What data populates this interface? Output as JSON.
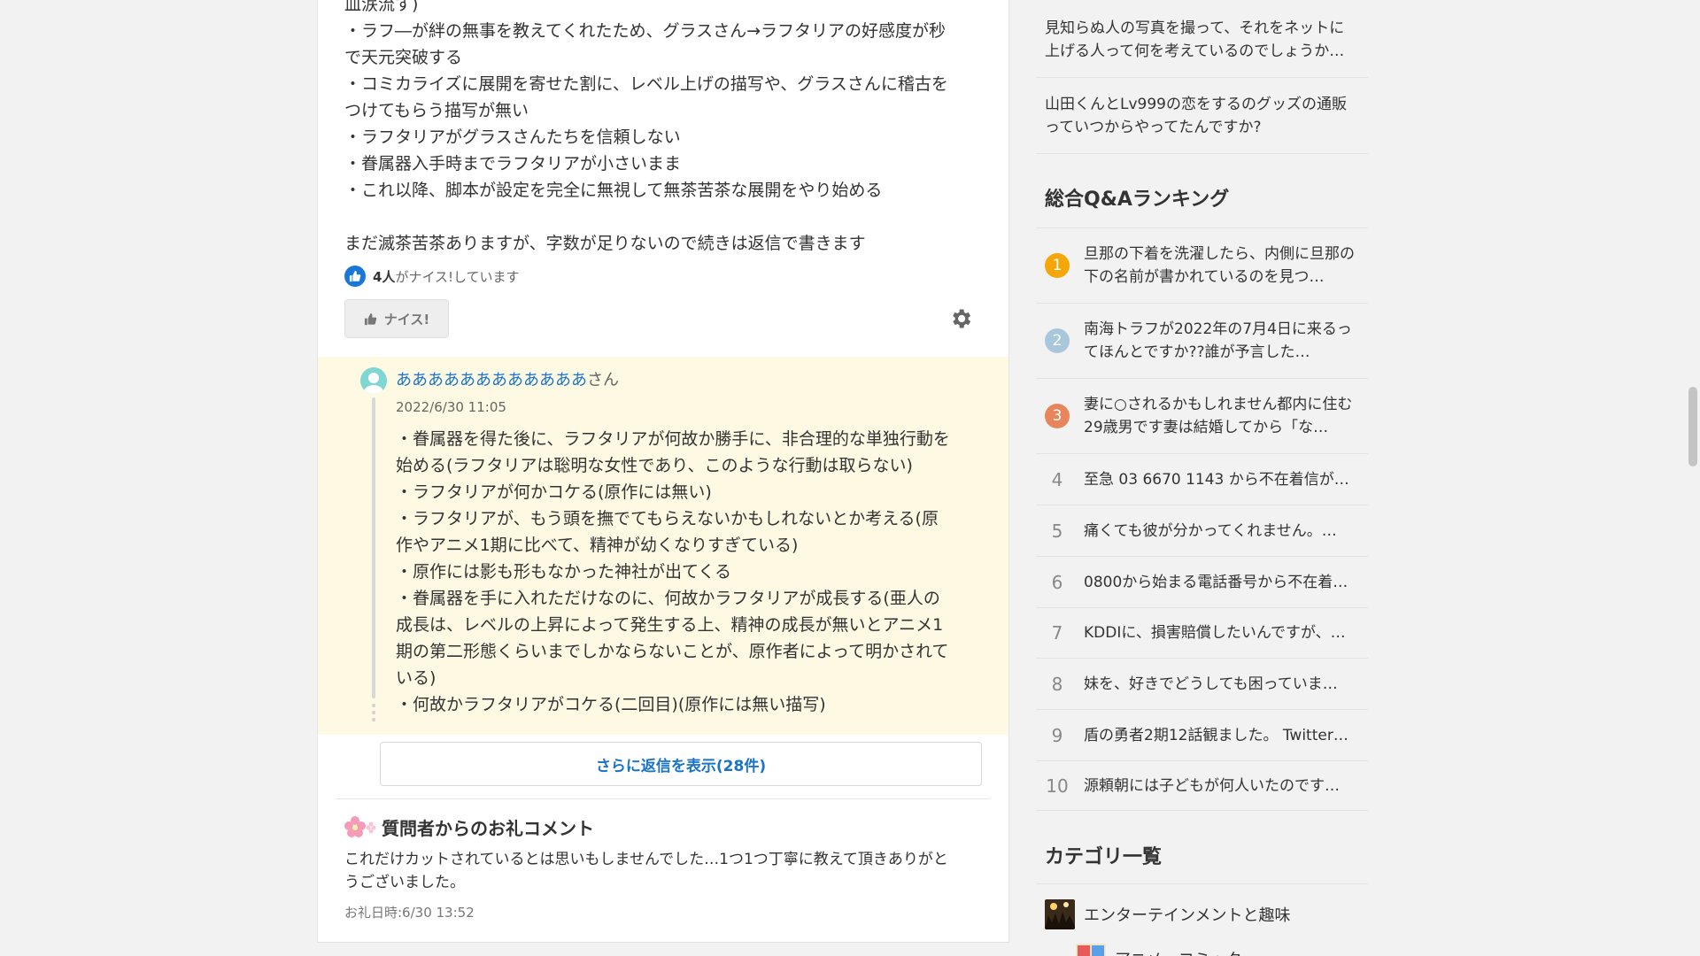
{
  "answer": {
    "lines": [
      "皿涙流す)",
      "・ラフ―が絆の無事を教えてくれたため、グラスさん→ラフタリアの好感度が秒",
      "で天元突破する",
      "・コミカライズに展開を寄せた割に、レベル上げの描写や、グラスさんに稽古を",
      "つけてもらう描写が無い",
      "・ラフタリアがグラスさんたちを信頼しない",
      "・眷属器入手時までラフタリアが小さいまま",
      "・これ以降、脚本が設定を完全に無視して無茶苦茶な展開をやり始める",
      "",
      "まだ滅茶苦茶ありますが、字数が足りないので続きは返信で書きます"
    ],
    "nice_count": "4人",
    "nice_suffix": "がナイス!しています",
    "nice_button": "ナイス!"
  },
  "reply": {
    "username": "ああああああああああああ",
    "honorific": "さん",
    "date": "2022/6/30 11:05",
    "lines": [
      "・眷属器を得た後に、ラフタリアが何故か勝手に、非合理的な単独行動を",
      "始める(ラフタリアは聡明な女性であり、このような行動は取らない)",
      "・ラフタリアが何かコケる(原作には無い)",
      "・ラフタリアが、もう頭を撫でてもらえないかもしれないとか考える(原",
      "作やアニメ1期に比べて、精神が幼くなりすぎている)",
      "・原作には影も形もなかった神社が出てくる",
      "・眷属器を手に入れただけなのに、何故かラフタリアが成長する(亜人の",
      "成長は、レベルの上昇によって発生する上、精神の成長が無いとアニメ1",
      "期の第二形態くらいまでしかならないことが、原作者によって明かされて",
      "いる)",
      "・何故かラフタリアがコケる(二回目)(原作には無い描写)"
    ],
    "more_label": "さらに返信を表示(28件)"
  },
  "thanks": {
    "title": "質問者からのお礼コメント",
    "body_lines": [
      "これだけカットされているとは思いもしませんでした…1つ1つ丁寧に教えて頂きありがと",
      "うございました。"
    ],
    "date": "お礼日時:6/30 13:52"
  },
  "sidebar": {
    "related": [
      {
        "line1": "見知らぬ人の写真を撮って、それをネットに",
        "line2": "上げる人って何を考えているのでしょうか…"
      },
      {
        "line1": "山田くんとLv999の恋をするのグッズの通販",
        "line2": "っていつからやってたんですか?"
      }
    ],
    "ranking_title": "総合Q&Aランキング",
    "ranking": [
      {
        "rank": "1",
        "text": "旦那の下着を洗濯したら、内側に旦那の下の名前が書かれているのを見つ…",
        "badge_color": "#f5a70a"
      },
      {
        "rank": "2",
        "text": "南海トラフが2022年の7月4日に来るってほんとですか??誰が予言した…",
        "badge_color": "#a9c7dc"
      },
      {
        "rank": "3",
        "text": "妻に○されるかもしれません都内に住む29歳男です妻は結婚してから「な…",
        "badge_color": "#e8855a"
      },
      {
        "rank": "4",
        "text": "至急 03 6670 1143 から不在着信が…"
      },
      {
        "rank": "5",
        "text": "痛くても彼が分かってくれません。…"
      },
      {
        "rank": "6",
        "text": "0800から始まる電話番号から不在着…"
      },
      {
        "rank": "7",
        "text": "KDDIに、損害賠償したいんですが、…"
      },
      {
        "rank": "8",
        "text": "妹を、好きでどうしても困っていま…"
      },
      {
        "rank": "9",
        "text": "盾の勇者2期12話観ました。 Twitter…"
      },
      {
        "rank": "10",
        "text": "源頼朝には子どもが何人いたのです…"
      }
    ],
    "category_title": "カテゴリ一覧",
    "categories": [
      {
        "label": "エンターテインメントと趣味"
      },
      {
        "label": "アニメ、コミック"
      }
    ]
  }
}
